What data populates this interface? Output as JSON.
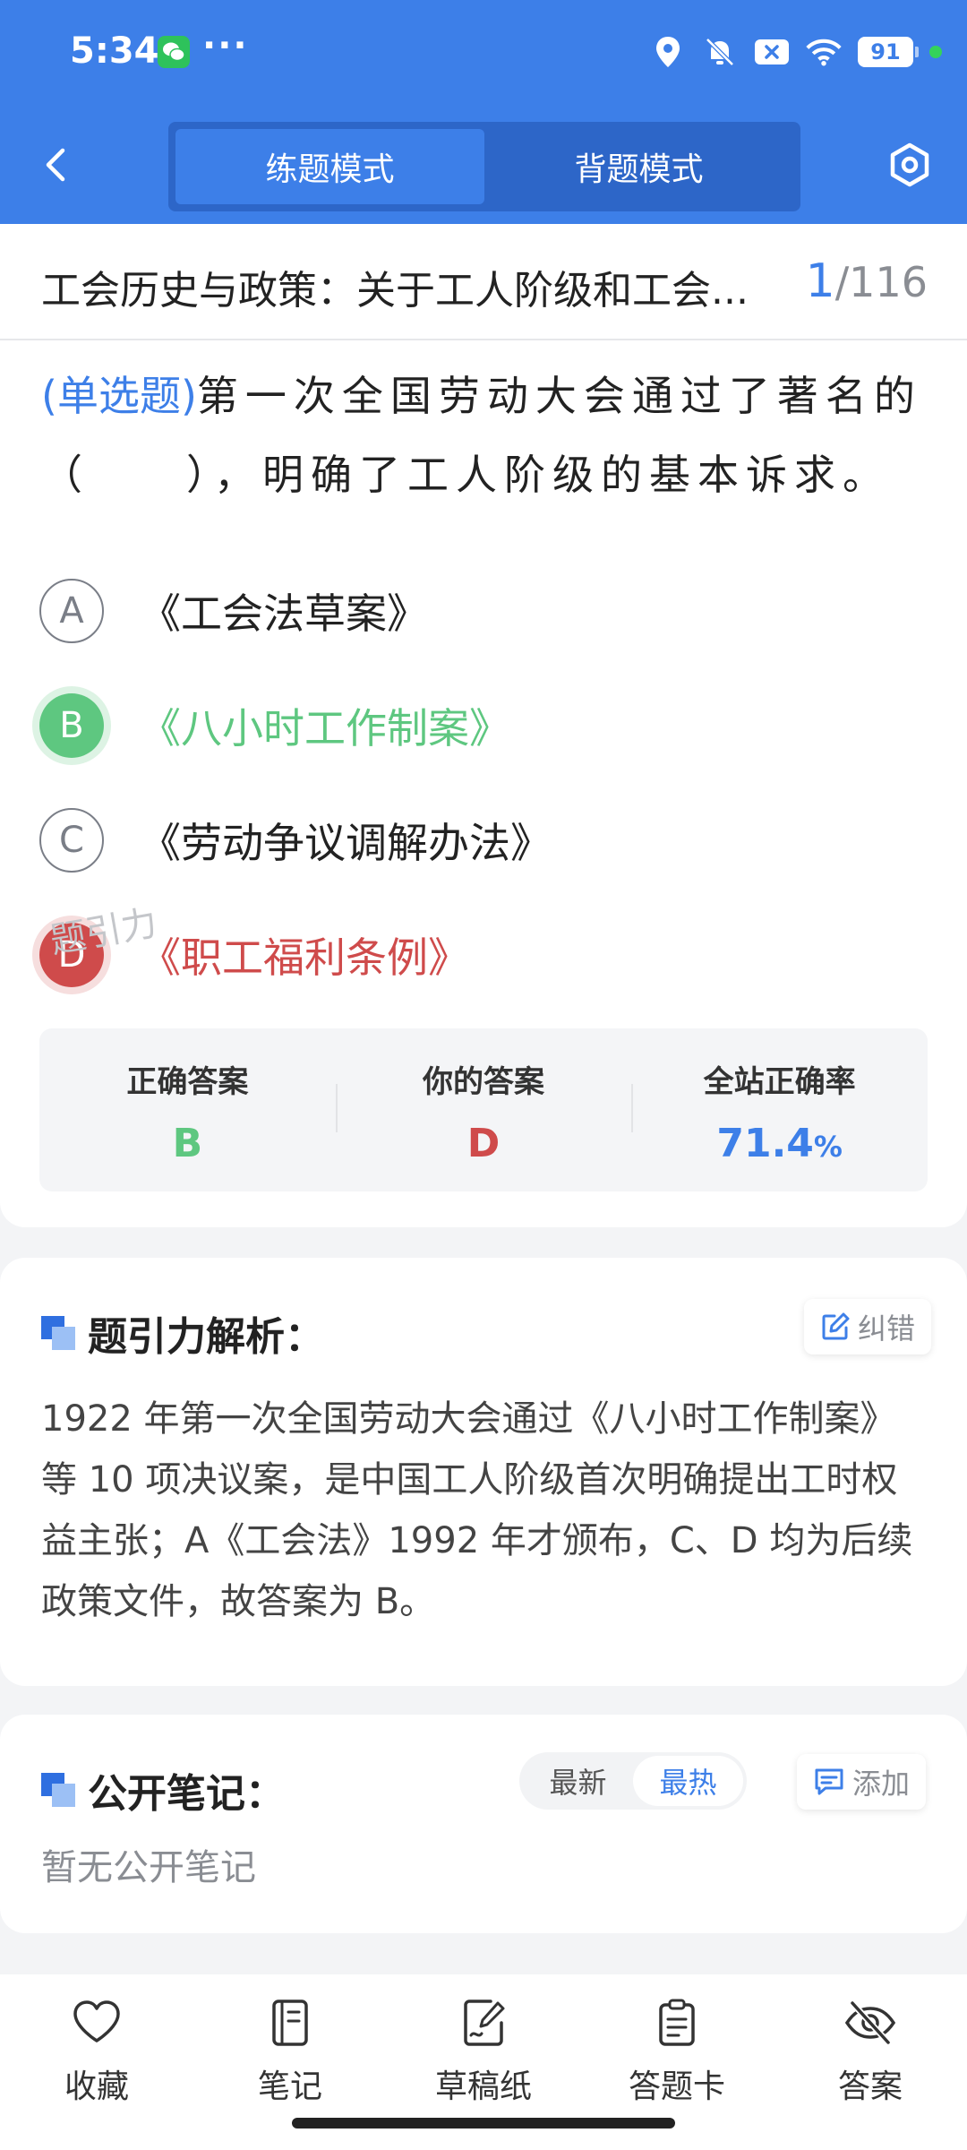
{
  "status_bar": {
    "time": "5:34",
    "dots": "···",
    "battery": "91",
    "icons": [
      "wechat-icon",
      "location-icon",
      "bell-off-icon",
      "close-box-icon",
      "wifi-icon"
    ]
  },
  "header": {
    "modes": [
      {
        "label": "练题模式",
        "active": true
      },
      {
        "label": "背题模式",
        "active": false
      }
    ]
  },
  "question": {
    "title": "工会历史与政策：关于工人阶级和工会...",
    "current": "1",
    "total": "/116",
    "type_label": "(单选题)",
    "text": "第一次全国劳动大会通过了著名的（　　），明确了工人阶级的基本诉求。",
    "options": [
      {
        "letter": "A",
        "text": "《工会法草案》",
        "state": "normal"
      },
      {
        "letter": "B",
        "text": "《八小时工作制案》",
        "state": "correct"
      },
      {
        "letter": "C",
        "text": "《劳动争议调解办法》",
        "state": "normal"
      },
      {
        "letter": "D",
        "text": "《职工福利条例》",
        "state": "wrong"
      }
    ]
  },
  "stats": {
    "correct_label": "正确答案",
    "correct_value": "B",
    "yours_label": "你的答案",
    "yours_value": "D",
    "rate_label": "全站正确率",
    "rate_value": "71.4",
    "rate_unit": "%",
    "watermark": "题引力"
  },
  "analysis": {
    "title": "题引力解析：",
    "fix_label": "纠错",
    "text": "1922 年第一次全国劳动大会通过《八小时工作制案》等 10 项决议案，是中国工人阶级首次明确提出工时权益主张；A《工会法》1992 年才颁布，C、D 均为后续政策文件，故答案为 B。"
  },
  "notes": {
    "title": "公开笔记：",
    "sort_latest": "最新",
    "sort_hot": "最热",
    "add_label": "添加",
    "empty_text": "暂无公开笔记"
  },
  "bottom_bar": [
    {
      "label": "收藏",
      "icon": "heart-icon"
    },
    {
      "label": "笔记",
      "icon": "notebook-icon"
    },
    {
      "label": "草稿纸",
      "icon": "draft-paper-icon"
    },
    {
      "label": "答题卡",
      "icon": "answer-card-icon"
    },
    {
      "label": "答案",
      "icon": "eye-off-icon"
    }
  ],
  "colors": {
    "primary": "#3d7fe8",
    "correct": "#5ec780",
    "wrong": "#cf4b4b"
  }
}
